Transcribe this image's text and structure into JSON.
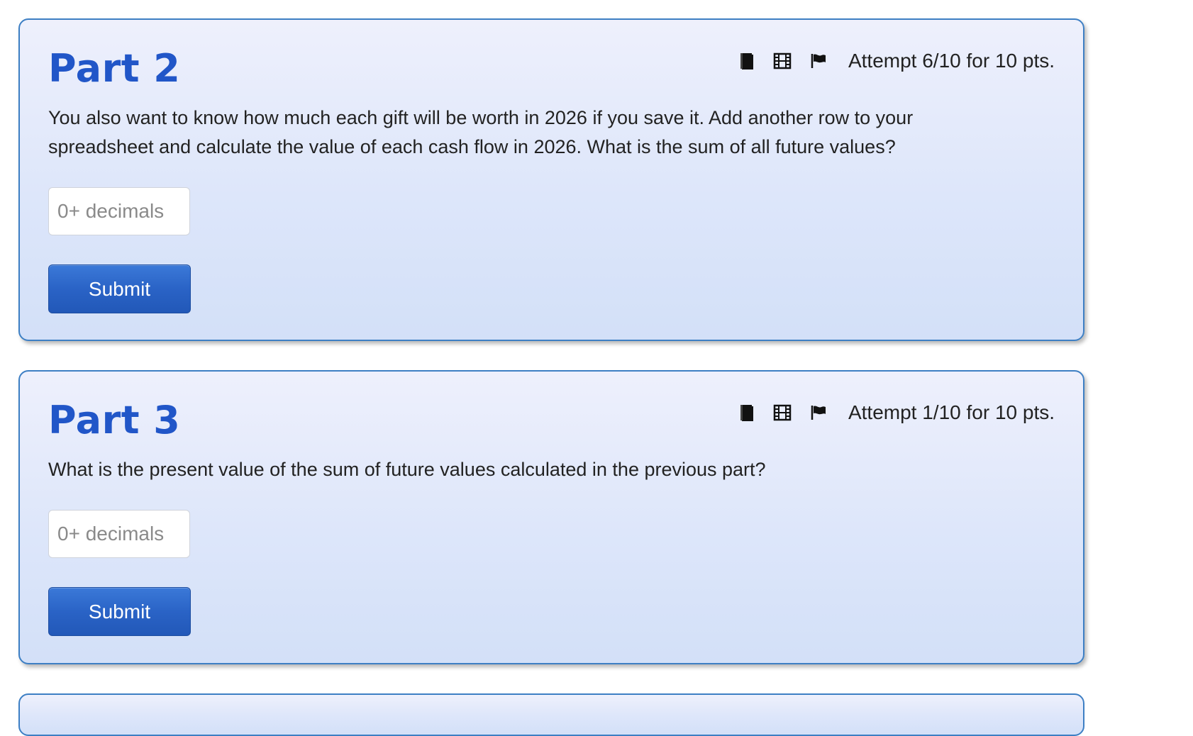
{
  "parts": [
    {
      "title": "Part 2",
      "attempt": "Attempt 6/10 for 10 pts.",
      "question": "You also want to know how much each gift will be worth in 2026 if you save it. Add another row to your spreadsheet and calculate the value of each cash flow in 2026. What is the sum of all future values?",
      "input_placeholder": "0+ decimals",
      "input_value": "",
      "submit_label": "Submit"
    },
    {
      "title": "Part 3",
      "attempt": "Attempt 1/10 for 10 pts.",
      "question": "What is the present value of the sum of future values calculated in the previous part?",
      "input_placeholder": "0+ decimals",
      "input_value": "",
      "submit_label": "Submit"
    }
  ],
  "icons": {
    "book": "book-icon",
    "video": "film-icon",
    "flag": "flag-icon"
  },
  "colors": {
    "title": "#2156c8",
    "card_border": "#3d7fc4",
    "button": "#2a63c6"
  }
}
